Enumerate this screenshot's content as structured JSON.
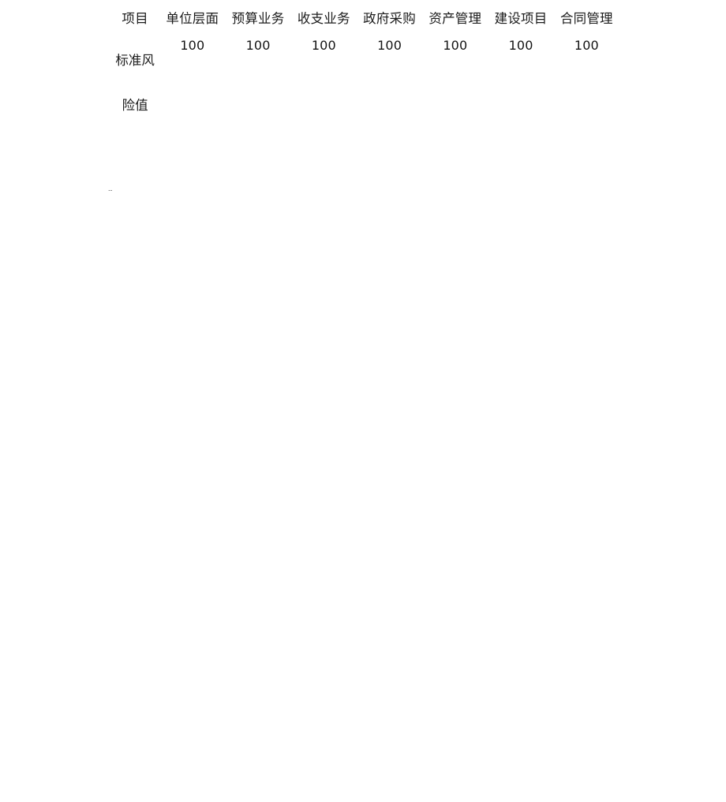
{
  "document": {
    "background_color": "#ffffff",
    "text_color": "#1a1a1a",
    "artifact_mark": "···"
  },
  "table": {
    "headers": [
      "项目",
      "单位层面",
      "预算业务",
      "收支业务",
      "政府采购",
      "资产管理",
      "建设项目",
      "合同管理"
    ],
    "rows": [
      {
        "label": "标准风险值",
        "values": [
          "100",
          "100",
          "100",
          "100",
          "100",
          "100",
          "100"
        ]
      }
    ]
  }
}
